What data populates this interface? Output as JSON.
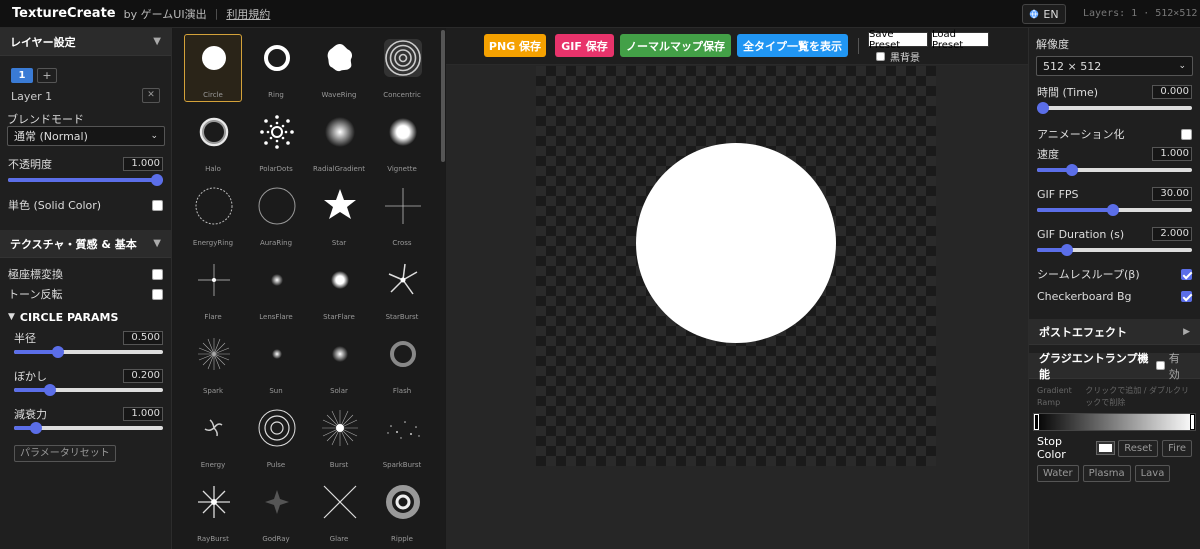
{
  "header": {
    "logo": "TextureCreate",
    "byline": "by ゲームUI演出",
    "terms": "利用規約",
    "lang": "EN",
    "layers_info": "Layers: 1 · 512×512"
  },
  "left": {
    "layer_section": "レイヤー設定",
    "layer_tab": "1",
    "add_layer": "+",
    "layer_name": "Layer 1",
    "remove": "✕",
    "blend_label": "ブレンドモード",
    "blend_value": "通常 (Normal)",
    "opacity_label": "不透明度",
    "opacity_value": "1.000",
    "opacity_level": 1.0,
    "solid_label": "単色 (Solid Color)",
    "texture_section": "テクスチャ・質感 & 基本",
    "polar_label": "極座標変換",
    "tone_label": "トーン反転",
    "params_title": "CIRCLE PARAMS",
    "radius_label": "半径",
    "radius_value": "0.500",
    "radius_level": 0.28,
    "blur_label": "ぼかし",
    "blur_value": "0.200",
    "blur_level": 0.22,
    "decay_label": "減衰力",
    "decay_value": "1.000",
    "decay_level": 0.12,
    "reset_params": "パラメータリセット"
  },
  "types": [
    "Circle",
    "Ring",
    "WaveRing",
    "Concentric",
    "Halo",
    "PolarDots",
    "RadialGradient",
    "Vignette",
    "EnergyRing",
    "AuraRing",
    "Star",
    "Cross",
    "Flare",
    "LensFlare",
    "StarFlare",
    "StarBurst",
    "Spark",
    "Sun",
    "Solar",
    "Flash",
    "Energy",
    "Pulse",
    "Burst",
    "SparkBurst",
    "RayBurst",
    "GodRay",
    "Glare",
    "Ripple"
  ],
  "toolbar": {
    "png": "PNG 保存",
    "gif": "GIF 保存",
    "normal": "ノーマルマップ保存",
    "all_types": "全タイプ一覧を表示",
    "save_preset": "Save Preset",
    "load_preset": "Load Preset",
    "black_bg": "黒背景"
  },
  "colors": {
    "png": "#f5a100",
    "gif": "#e8336b",
    "normal": "#43a047",
    "all": "#2196f3",
    "accent": "#5b6ee8",
    "selected": "#d4a23a"
  },
  "right": {
    "resolution_label": "解像度",
    "resolution_value": "512 × 512",
    "time_label": "時間 (Time)",
    "time_value": "0.000",
    "time_level": 0.0,
    "anim_label": "アニメーション化",
    "speed_label": "速度",
    "speed_value": "1.000",
    "speed_level": 0.2,
    "fps_label": "GIF FPS",
    "fps_value": "30.00",
    "fps_level": 0.49,
    "duration_label": "GIF Duration (s)",
    "duration_value": "2.000",
    "duration_level": 0.17,
    "seamless_label": "シームレスループ(β)",
    "checker_label": "Checkerboard Bg",
    "post_section": "ポストエフェクト",
    "gradient_section": "グラジエントランプ機能",
    "gradient_enable": "有効",
    "ramp_label": "Gradient Ramp",
    "ramp_hint": "クリックで追加 / ダブルクリックで削除",
    "stop_color_label": "Stop Color",
    "reset": "Reset",
    "fire": "Fire",
    "water": "Water",
    "plasma": "Plasma",
    "lava": "Lava"
  }
}
